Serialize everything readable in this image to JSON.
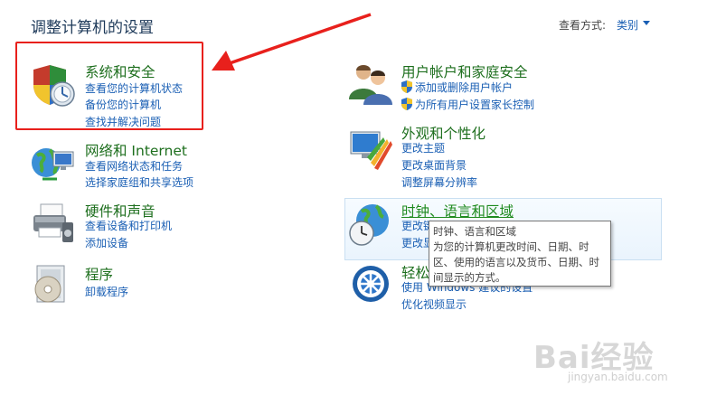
{
  "header": {
    "title": "调整计算机的设置",
    "view_by_label": "查看方式:",
    "view_by_value": "类别"
  },
  "categories": {
    "system": {
      "title": "系统和安全",
      "links": [
        "查看您的计算机状态",
        "备份您的计算机",
        "查找并解决问题"
      ]
    },
    "network": {
      "title": "网络和 Internet",
      "links": [
        "查看网络状态和任务",
        "选择家庭组和共享选项"
      ]
    },
    "hardware": {
      "title": "硬件和声音",
      "links": [
        "查看设备和打印机",
        "添加设备"
      ]
    },
    "programs": {
      "title": "程序",
      "links": [
        "卸载程序"
      ]
    },
    "users": {
      "title": "用户帐户和家庭安全",
      "links": [
        "添加或删除用户帐户",
        "为所有用户设置家长控制"
      ]
    },
    "appearance": {
      "title": "外观和个性化",
      "links": [
        "更改主题",
        "更改桌面背景",
        "调整屏幕分辨率"
      ]
    },
    "clock": {
      "title": "时钟、语言和区域",
      "links": [
        "更改键",
        "更改显"
      ]
    },
    "ease": {
      "title": "轻松",
      "links": [
        "使用 Windows 建议的设置",
        "优化视频显示"
      ]
    }
  },
  "tooltip": {
    "lines": [
      "时钟、语言和区域",
      "为您的计算机更改时间、日期、时",
      "区、使用的语言以及货币、日期、时",
      "间显示的方式。"
    ]
  },
  "watermark": {
    "main": "Bai经验",
    "sub": "jingyan.baidu.com"
  },
  "colors": {
    "annotation_red": "#e8201c",
    "category_green": "#1e6f1e",
    "link_blue": "#1a5fb4"
  }
}
